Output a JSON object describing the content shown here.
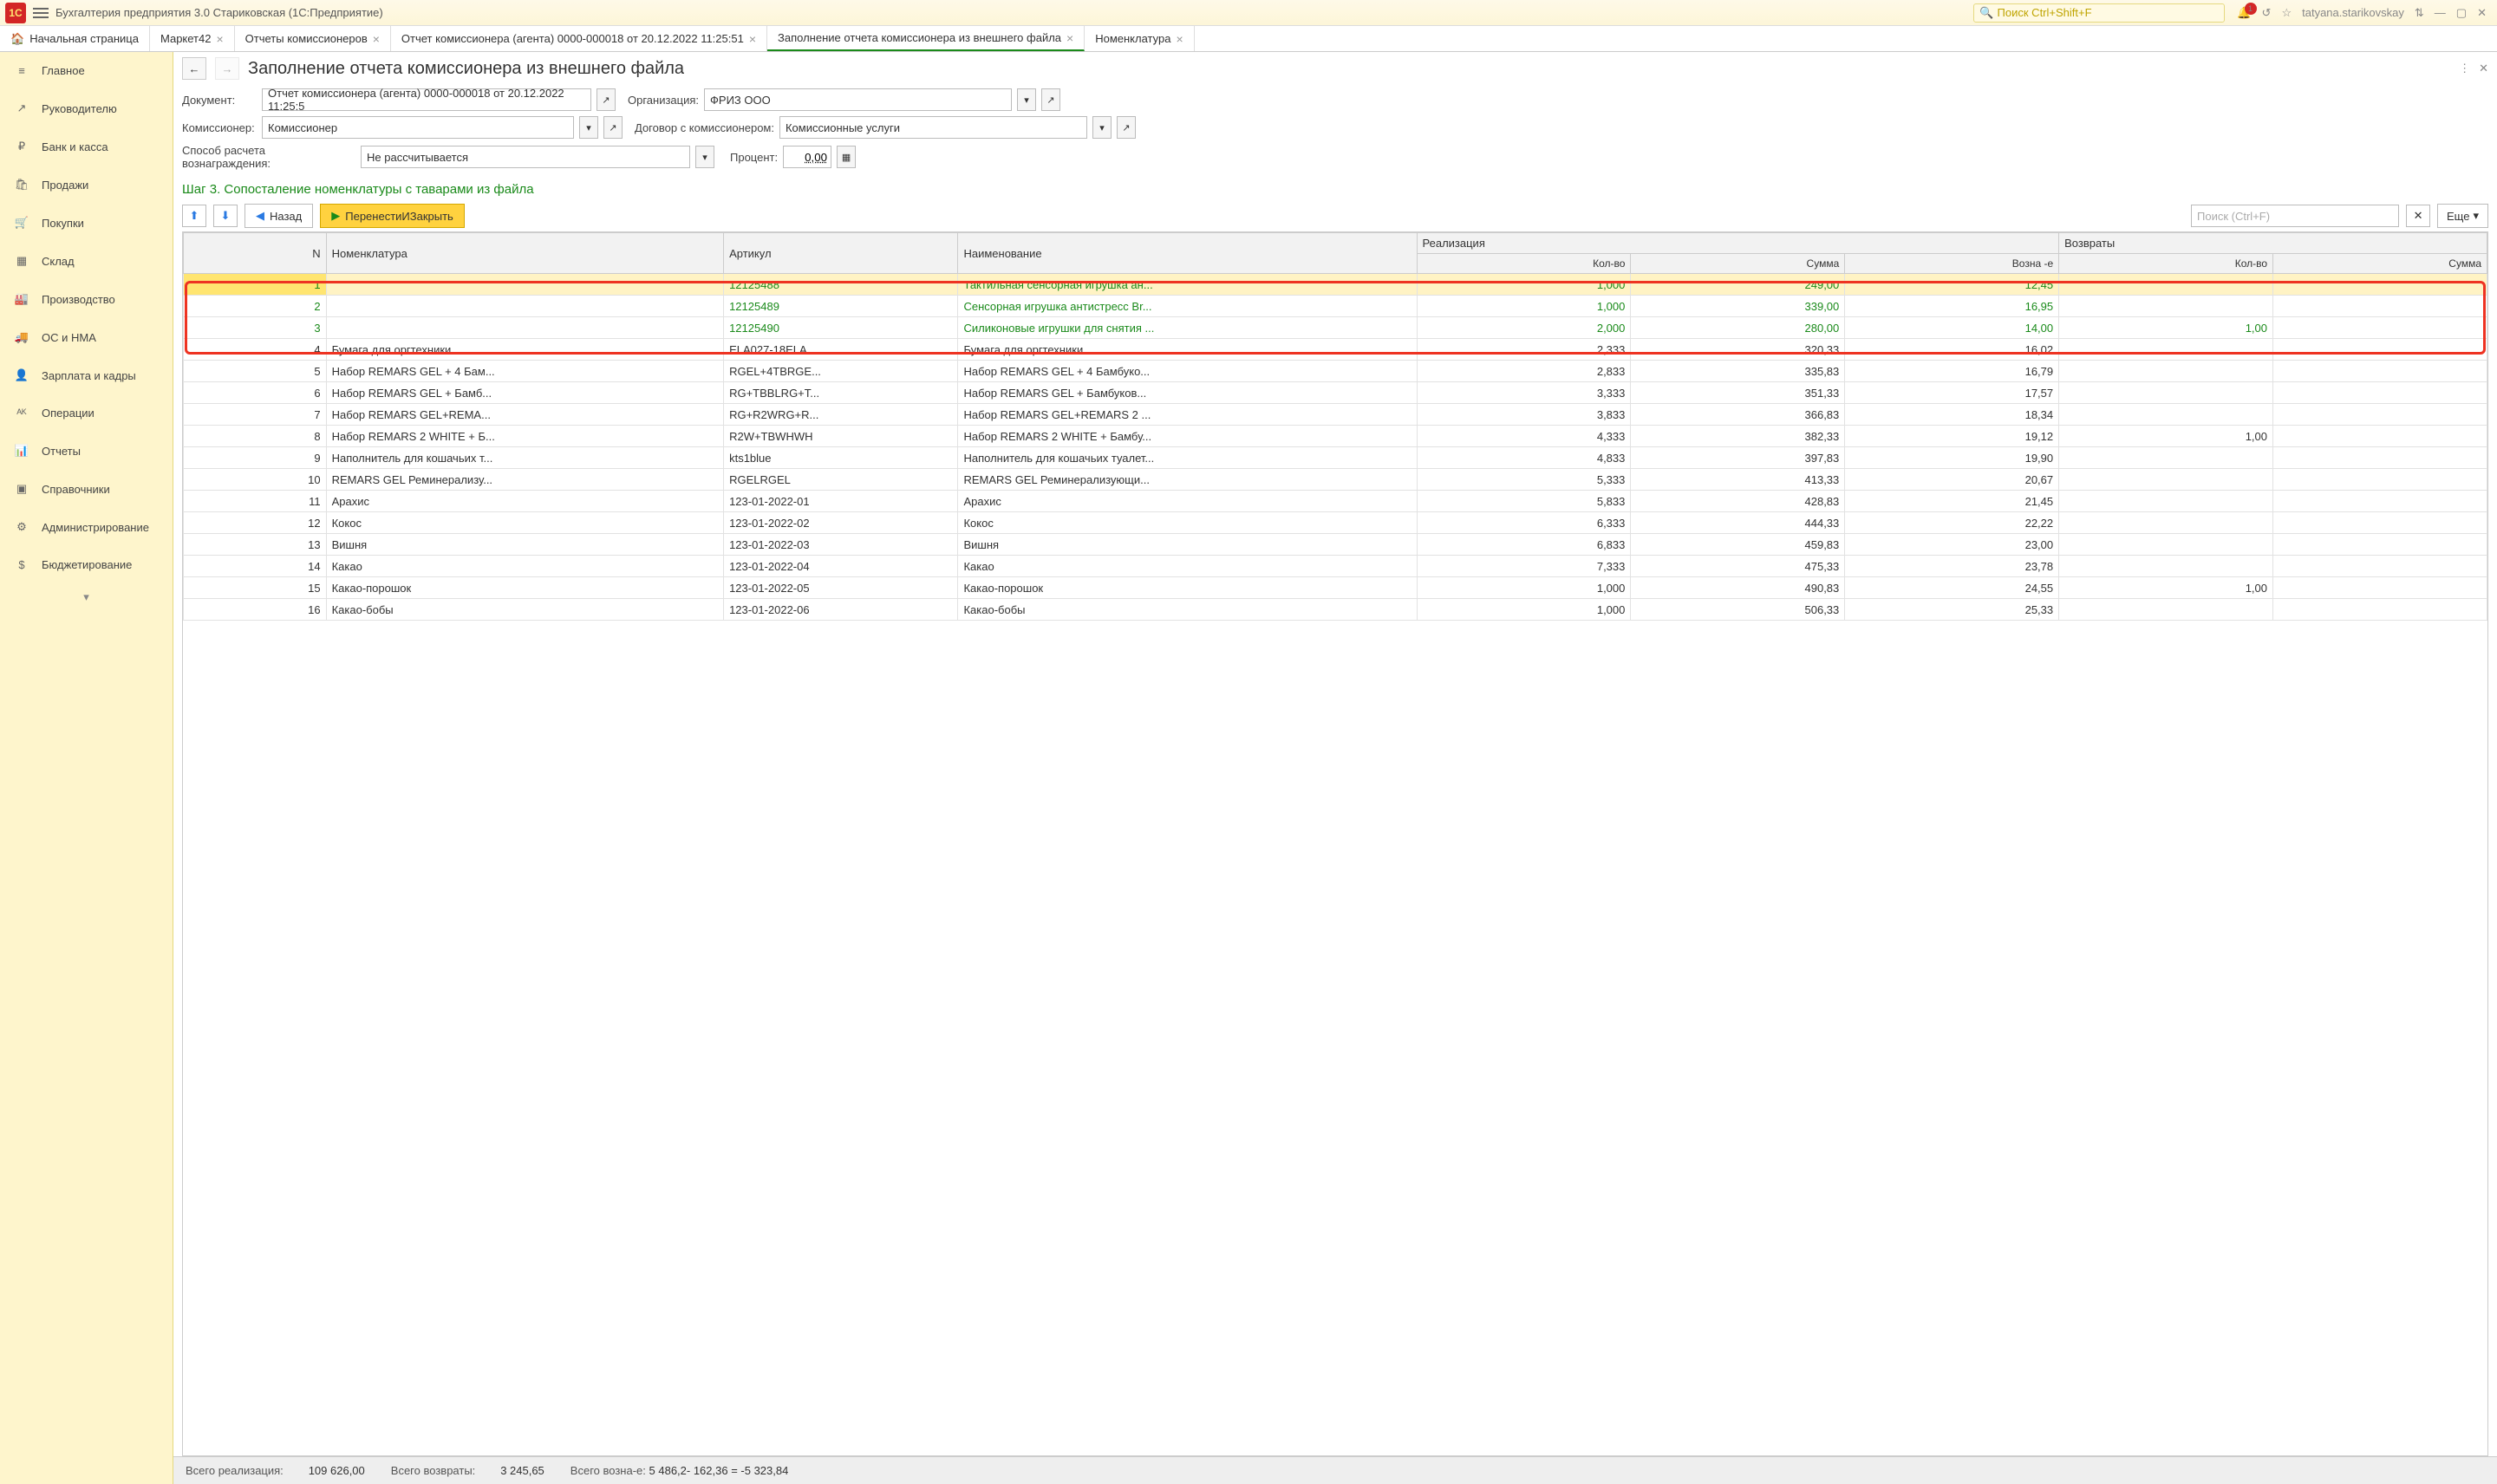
{
  "titlebar": {
    "title": "Бухгалтерия предприятия 3.0 Стариковская  (1С:Предприятие)",
    "search_placeholder": "Поиск Ctrl+Shift+F",
    "user": "tatyana.starikovskay",
    "badge": "1"
  },
  "tabs": [
    {
      "label": "Начальная страница",
      "home": true
    },
    {
      "label": "Маркет42"
    },
    {
      "label": "Отчеты комиссионеров"
    },
    {
      "label": "Отчет комиссионера (агента) 0000-000018 от 20.12.2022 11:25:51"
    },
    {
      "label": "Заполнение  отчета комиссионера из внешнего  файла",
      "active": true
    },
    {
      "label": "Номенклатура"
    }
  ],
  "sidebar": [
    {
      "icon": "≡",
      "label": "Главное"
    },
    {
      "icon": "↗",
      "label": "Руководителю"
    },
    {
      "icon": "₽",
      "label": "Банк и касса"
    },
    {
      "icon": "🛍",
      "label": "Продажи"
    },
    {
      "icon": "🛒",
      "label": "Покупки"
    },
    {
      "icon": "▦",
      "label": "Склад"
    },
    {
      "icon": "🏭",
      "label": "Производство"
    },
    {
      "icon": "🚚",
      "label": "ОС и НМА"
    },
    {
      "icon": "👤",
      "label": "Зарплата и кадры"
    },
    {
      "icon": "ᴬᴷ",
      "label": "Операции"
    },
    {
      "icon": "📊",
      "label": "Отчеты"
    },
    {
      "icon": "▣",
      "label": "Справочники"
    },
    {
      "icon": "⚙",
      "label": "Администрирование"
    },
    {
      "icon": "$",
      "label": "Бюджетирование"
    }
  ],
  "page_title": "Заполнение  отчета комиссионера из внешнего  файла",
  "form": {
    "doc_label": "Документ:",
    "doc_value": "Отчет комиссионера (агента) 0000-000018 от 20.12.2022 11:25:5",
    "org_label": "Организация:",
    "org_value": "ФРИЗ ООО",
    "kom_label": "Комиссионер:",
    "kom_value": "Комиссионер",
    "dog_label": "Договор с комиссионером:",
    "dog_value": "Комиссионные услуги",
    "calc_label": "Способ расчета вознаграждения:",
    "calc_value": "Не рассчитывается",
    "pct_label": "Процент:",
    "pct_value": "0,00"
  },
  "step_title": "Шаг 3. Сопосталение номенклатуры с таварами из файла",
  "toolbar": {
    "back": "Назад",
    "transfer": "ПеренестиИЗакрыть",
    "search_ph": "Поиск (Ctrl+F)",
    "more": "Еще"
  },
  "headers": {
    "n": "N",
    "nom": "Номенклатура",
    "art": "Артикул",
    "name": "Наименование",
    "real": "Реализация",
    "ret": "Возвраты",
    "qty": "Кол-во",
    "sum": "Сумма",
    "fee": "Возна -е",
    "rqty": "Кол-во",
    "rsum": "Сумма"
  },
  "rows": [
    {
      "n": 1,
      "nom": "",
      "art": "12125488",
      "name": "Тактильная сенсорная игрушка ан...",
      "qty": "1,000",
      "sum": "249,00",
      "fee": "12,45",
      "rqty": "",
      "rsum": "",
      "green": true,
      "sel": true
    },
    {
      "n": 2,
      "nom": "",
      "art": "12125489",
      "name": "Сенсорная игрушка антистресс Br...",
      "qty": "1,000",
      "sum": "339,00",
      "fee": "16,95",
      "rqty": "",
      "rsum": "",
      "green": true
    },
    {
      "n": 3,
      "nom": "",
      "art": "12125490",
      "name": "Силиконовые игрушки для снятия ...",
      "qty": "2,000",
      "sum": "280,00",
      "fee": "14,00",
      "rqty": "1,00",
      "rsum": "",
      "green": true
    },
    {
      "n": 4,
      "nom": "Бумага для оргтехники",
      "art": "ELA027-18ELA...",
      "name": "Бумага для оргтехники",
      "qty": "2,333",
      "sum": "320,33",
      "fee": "16,02",
      "rqty": "",
      "rsum": ""
    },
    {
      "n": 5,
      "nom": "Набор REMARS GEL + 4 Бам...",
      "art": "RGEL+4TBRGE...",
      "name": "Набор REMARS GEL + 4 Бамбуко...",
      "qty": "2,833",
      "sum": "335,83",
      "fee": "16,79",
      "rqty": "",
      "rsum": ""
    },
    {
      "n": 6,
      "nom": "Набор REMARS GEL + Бамб...",
      "art": "RG+TBBLRG+T...",
      "name": "Набор REMARS GEL + Бамбуков...",
      "qty": "3,333",
      "sum": "351,33",
      "fee": "17,57",
      "rqty": "",
      "rsum": ""
    },
    {
      "n": 7,
      "nom": "Набор REMARS GEL+REMA...",
      "art": "RG+R2WRG+R...",
      "name": "Набор REMARS GEL+REMARS 2 ...",
      "qty": "3,833",
      "sum": "366,83",
      "fee": "18,34",
      "rqty": "",
      "rsum": ""
    },
    {
      "n": 8,
      "nom": "Набор REMARS 2 WHITE + Б...",
      "art": "R2W+TBWHWH",
      "name": "Набор REMARS 2 WHITE + Бамбу...",
      "qty": "4,333",
      "sum": "382,33",
      "fee": "19,12",
      "rqty": "1,00",
      "rsum": ""
    },
    {
      "n": 9,
      "nom": "Наполнитель для кошачьих т...",
      "art": "kts1blue",
      "name": "Наполнитель для кошачьих туалет...",
      "qty": "4,833",
      "sum": "397,83",
      "fee": "19,90",
      "rqty": "",
      "rsum": ""
    },
    {
      "n": 10,
      "nom": "REMARS GEL Реминерализу...",
      "art": "RGELRGEL",
      "name": "REMARS GEL Реминерализующи...",
      "qty": "5,333",
      "sum": "413,33",
      "fee": "20,67",
      "rqty": "",
      "rsum": ""
    },
    {
      "n": 11,
      "nom": "Арахис",
      "art": "123-01-2022-01",
      "name": "Арахис",
      "qty": "5,833",
      "sum": "428,83",
      "fee": "21,45",
      "rqty": "",
      "rsum": ""
    },
    {
      "n": 12,
      "nom": "Кокос",
      "art": "123-01-2022-02",
      "name": "Кокос",
      "qty": "6,333",
      "sum": "444,33",
      "fee": "22,22",
      "rqty": "",
      "rsum": ""
    },
    {
      "n": 13,
      "nom": "Вишня",
      "art": "123-01-2022-03",
      "name": "Вишня",
      "qty": "6,833",
      "sum": "459,83",
      "fee": "23,00",
      "rqty": "",
      "rsum": ""
    },
    {
      "n": 14,
      "nom": "Какао",
      "art": "123-01-2022-04",
      "name": "Какао",
      "qty": "7,333",
      "sum": "475,33",
      "fee": "23,78",
      "rqty": "",
      "rsum": ""
    },
    {
      "n": 15,
      "nom": "Какао-порошок",
      "art": "123-01-2022-05",
      "name": "Какао-порошок",
      "qty": "1,000",
      "sum": "490,83",
      "fee": "24,55",
      "rqty": "1,00",
      "rsum": ""
    },
    {
      "n": 16,
      "nom": "Какао-бобы",
      "art": "123-01-2022-06",
      "name": "Какао-бобы",
      "qty": "1,000",
      "sum": "506,33",
      "fee": "25,33",
      "rqty": "",
      "rsum": ""
    }
  ],
  "footer": {
    "real_label": "Всего реализация:",
    "real_val": "109 626,00",
    "ret_label": "Всего возвраты:",
    "ret_val": "3 245,65",
    "fee_label": "Всего возна-е:",
    "fee_val": "5 486,2- 162,36 = -5 323,84"
  }
}
